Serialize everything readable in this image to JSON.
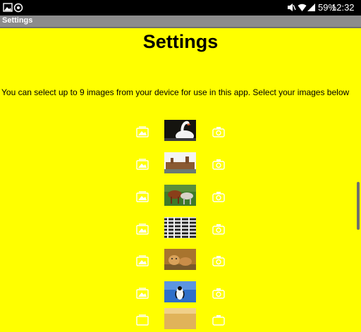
{
  "status_bar": {
    "battery_percent": "59%",
    "time": "12:32",
    "icons": [
      "image-icon",
      "sync-icon",
      "mute-icon",
      "wifi-icon",
      "signal-icon",
      "battery-icon"
    ]
  },
  "action_bar": {
    "title": "Settings"
  },
  "page": {
    "title": "Settings",
    "intro": "You can select up to 9 images from your device for use in this app. Select your images below"
  },
  "image_rows": [
    {
      "thumbnail": "swan"
    },
    {
      "thumbnail": "parliament-building"
    },
    {
      "thumbnail": "horses"
    },
    {
      "thumbnail": "zebras"
    },
    {
      "thumbnail": "lion-cubs"
    },
    {
      "thumbnail": "penguin"
    },
    {
      "thumbnail": "desert"
    }
  ],
  "colors": {
    "background": "#ffff00",
    "status_bar": "#000000",
    "action_bar": "#8c8c8c",
    "icons": "#ffffff"
  }
}
